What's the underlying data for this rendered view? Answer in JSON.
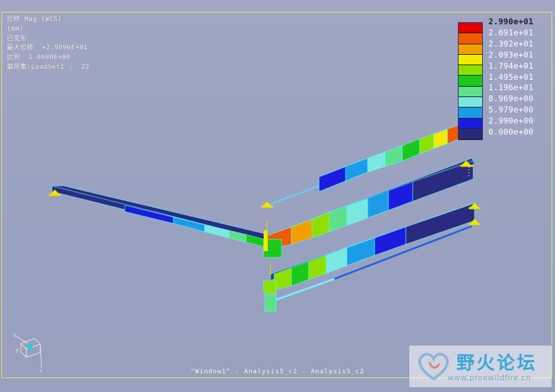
{
  "header": {
    "lines": [
      "位移 Mag (WCS)",
      "(mm)",
      "已变形",
      "最大位移  +2.9896E+01",
      "比例  1.0000E+00",
      "载荷集:LoadSet1 :  Z2"
    ]
  },
  "legend": {
    "labels": [
      "2.990e+01",
      "2.691e+01",
      "2.392e+01",
      "2.093e+01",
      "1.794e+01",
      "1.495e+01",
      "1.196e+01",
      "8.969e+00",
      "5.979e+00",
      "2.990e+00",
      "0.000e+00"
    ],
    "colors": [
      "#e00000",
      "#f05a00",
      "#f2a000",
      "#f2ea00",
      "#8ee000",
      "#1cc81c",
      "#5ee08a",
      "#7ae8e0",
      "#1c9ce8",
      "#1c1ce0",
      "#2a2a80"
    ]
  },
  "footer": {
    "title": "\"Window1\" - Analysis5_c2 - Analysis5_c2"
  },
  "watermark": {
    "text": "野火论坛",
    "url": "www.proewildfire.cn"
  },
  "icons": {
    "coordinate_system": "coordinate-axes-icon",
    "watermark_logo": "heart-logo-icon"
  }
}
